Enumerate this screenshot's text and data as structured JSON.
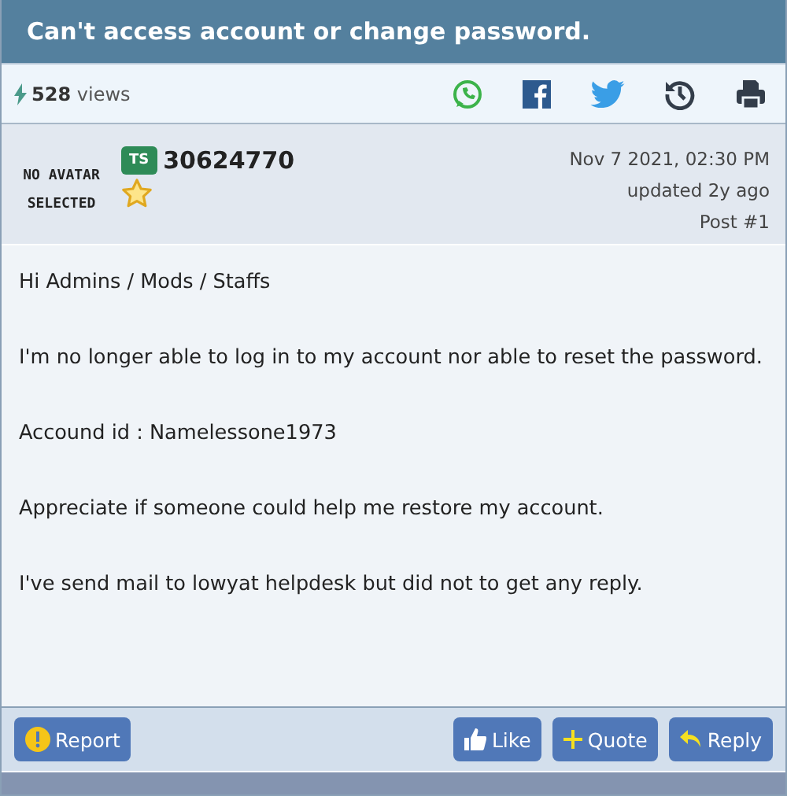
{
  "title": "Can't access account or change password.",
  "stats": {
    "count": "528",
    "label": "views"
  },
  "share_icons": [
    {
      "kind": "whatsapp"
    },
    {
      "kind": "facebook"
    },
    {
      "kind": "twitter"
    },
    {
      "kind": "history"
    },
    {
      "kind": "print"
    }
  ],
  "post": {
    "avatar_text": "NO AVATAR SELECTED",
    "badge": "TS",
    "username": "30624770",
    "date": "Nov 7 2021, 02:30 PM",
    "updated": "updated 2y ago",
    "number": "Post #1",
    "paragraphs": [
      "Hi Admins / Mods / Staffs",
      "I'm no longer able to log in to my account nor able to reset the password.",
      "Accound id : Namelessone1973",
      "Appreciate if someone could help me restore my account.",
      "I've send mail to lowyat helpdesk but did not to get any reply."
    ]
  },
  "actions": [
    {
      "kind": "report",
      "label": "Report"
    },
    {
      "kind": "like",
      "label": "Like"
    },
    {
      "kind": "quote",
      "label": "Quote"
    },
    {
      "kind": "reply",
      "label": "Reply"
    }
  ]
}
